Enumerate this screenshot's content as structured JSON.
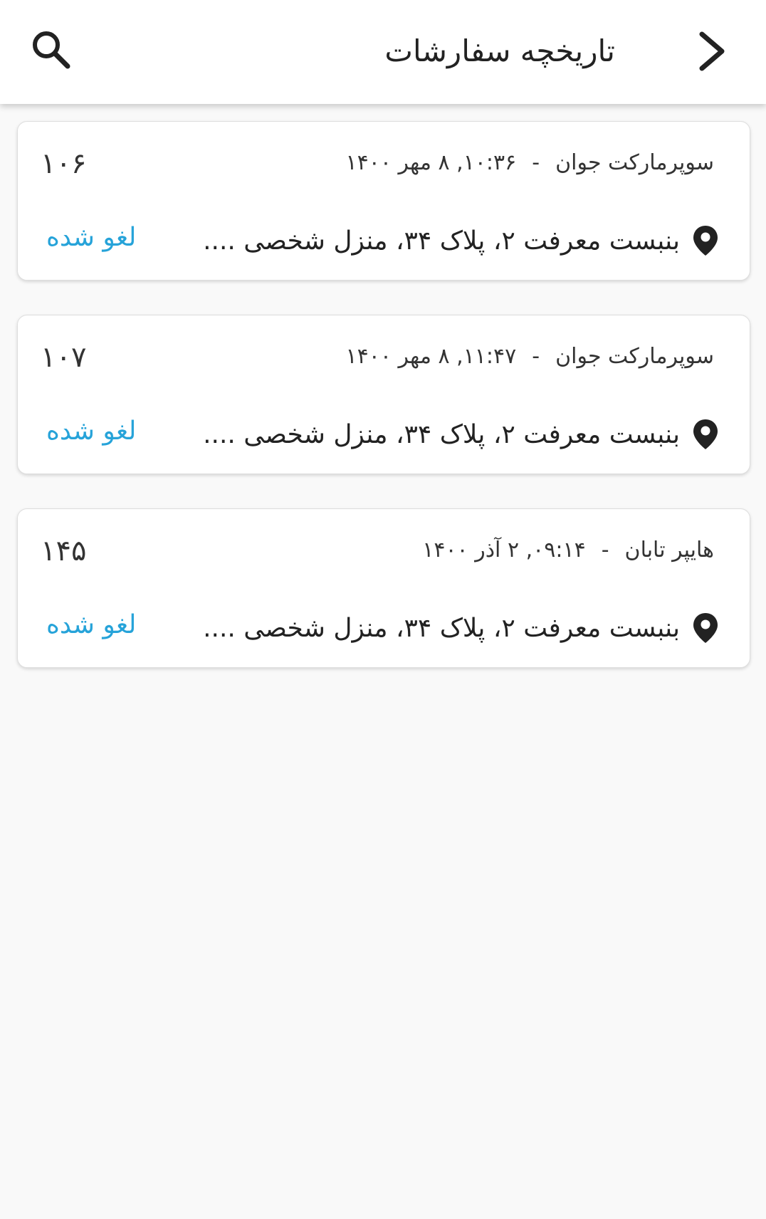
{
  "header": {
    "title": "تاریخچه سفارشات",
    "back_icon": "chevron-right-icon",
    "search_icon": "search-icon"
  },
  "orders": [
    {
      "number": "۱۰۶",
      "store": "سوپرمارکت جوان",
      "separator": "-",
      "datetime": "۱۰:۳۶, ۸ مهر ۱۴۰۰",
      "address": "بنبست معرفت ۲، پلاک ۳۴، منزل شخصی ....",
      "status": "لغو شده"
    },
    {
      "number": "۱۰۷",
      "store": "سوپرمارکت جوان",
      "separator": "-",
      "datetime": "۱۱:۴۷, ۸ مهر ۱۴۰۰",
      "address": "بنبست معرفت ۲، پلاک ۳۴، منزل شخصی ....",
      "status": "لغو شده"
    },
    {
      "number": "۱۴۵",
      "store": "هایپر تابان",
      "separator": "-",
      "datetime": "۰۹:۱۴, ۲ آذر ۱۴۰۰",
      "address": "بنبست معرفت ۲، پلاک ۳۴، منزل شخصی ....",
      "status": "لغو شده"
    }
  ],
  "colors": {
    "status": "#26a3d9",
    "text": "#222222",
    "background": "#f9f9f9"
  },
  "location_icon": "location-pin-icon"
}
